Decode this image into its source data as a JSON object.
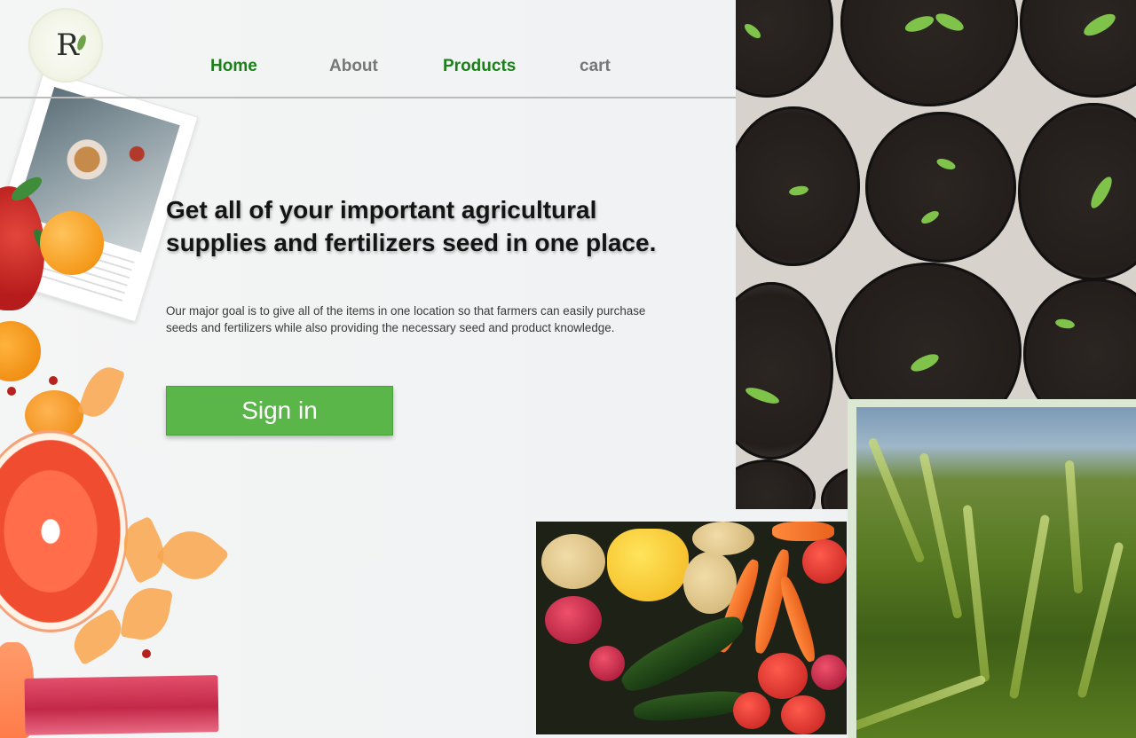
{
  "header": {
    "logo_text": "R",
    "nav": {
      "home": "Home",
      "about": "About",
      "products": "Products",
      "cart": "cart"
    }
  },
  "hero": {
    "headline_line1": "Get all of your important agricultural",
    "headline_line2": "supplies and fertilizers seed in one place.",
    "description": "Our major goal is to give all of the items in one location so that farmers can easily purchase seeds and fertilizers while also providing the necessary seed and product knowledge.",
    "signin_label": "Sign in"
  },
  "colors": {
    "accent_green": "#1d7f1b",
    "button_green": "#5bb64a",
    "nav_gray": "#777777",
    "text_dark": "#141414"
  },
  "images": {
    "left_collage": "fruits-and-recipe-card",
    "top_right": "seedlings-in-pots",
    "bottom_right": "wheat-field",
    "bottom_center": "assorted-vegetables"
  }
}
